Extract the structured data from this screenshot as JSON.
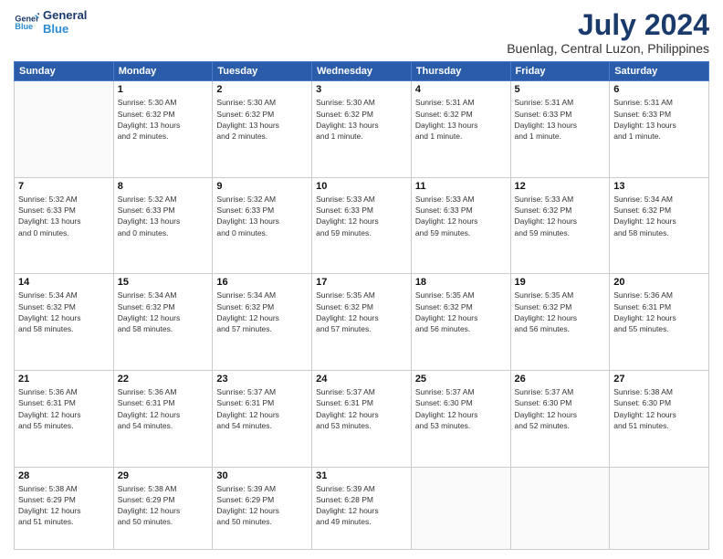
{
  "header": {
    "logo_line1": "General",
    "logo_line2": "Blue",
    "month": "July 2024",
    "location": "Buenlag, Central Luzon, Philippines"
  },
  "weekdays": [
    "Sunday",
    "Monday",
    "Tuesday",
    "Wednesday",
    "Thursday",
    "Friday",
    "Saturday"
  ],
  "weeks": [
    [
      {
        "day": "",
        "info": ""
      },
      {
        "day": "1",
        "info": "Sunrise: 5:30 AM\nSunset: 6:32 PM\nDaylight: 13 hours\nand 2 minutes."
      },
      {
        "day": "2",
        "info": "Sunrise: 5:30 AM\nSunset: 6:32 PM\nDaylight: 13 hours\nand 2 minutes."
      },
      {
        "day": "3",
        "info": "Sunrise: 5:30 AM\nSunset: 6:32 PM\nDaylight: 13 hours\nand 1 minute."
      },
      {
        "day": "4",
        "info": "Sunrise: 5:31 AM\nSunset: 6:32 PM\nDaylight: 13 hours\nand 1 minute."
      },
      {
        "day": "5",
        "info": "Sunrise: 5:31 AM\nSunset: 6:33 PM\nDaylight: 13 hours\nand 1 minute."
      },
      {
        "day": "6",
        "info": "Sunrise: 5:31 AM\nSunset: 6:33 PM\nDaylight: 13 hours\nand 1 minute."
      }
    ],
    [
      {
        "day": "7",
        "info": "Sunrise: 5:32 AM\nSunset: 6:33 PM\nDaylight: 13 hours\nand 0 minutes."
      },
      {
        "day": "8",
        "info": "Sunrise: 5:32 AM\nSunset: 6:33 PM\nDaylight: 13 hours\nand 0 minutes."
      },
      {
        "day": "9",
        "info": "Sunrise: 5:32 AM\nSunset: 6:33 PM\nDaylight: 13 hours\nand 0 minutes."
      },
      {
        "day": "10",
        "info": "Sunrise: 5:33 AM\nSunset: 6:33 PM\nDaylight: 12 hours\nand 59 minutes."
      },
      {
        "day": "11",
        "info": "Sunrise: 5:33 AM\nSunset: 6:33 PM\nDaylight: 12 hours\nand 59 minutes."
      },
      {
        "day": "12",
        "info": "Sunrise: 5:33 AM\nSunset: 6:32 PM\nDaylight: 12 hours\nand 59 minutes."
      },
      {
        "day": "13",
        "info": "Sunrise: 5:34 AM\nSunset: 6:32 PM\nDaylight: 12 hours\nand 58 minutes."
      }
    ],
    [
      {
        "day": "14",
        "info": "Sunrise: 5:34 AM\nSunset: 6:32 PM\nDaylight: 12 hours\nand 58 minutes."
      },
      {
        "day": "15",
        "info": "Sunrise: 5:34 AM\nSunset: 6:32 PM\nDaylight: 12 hours\nand 58 minutes."
      },
      {
        "day": "16",
        "info": "Sunrise: 5:34 AM\nSunset: 6:32 PM\nDaylight: 12 hours\nand 57 minutes."
      },
      {
        "day": "17",
        "info": "Sunrise: 5:35 AM\nSunset: 6:32 PM\nDaylight: 12 hours\nand 57 minutes."
      },
      {
        "day": "18",
        "info": "Sunrise: 5:35 AM\nSunset: 6:32 PM\nDaylight: 12 hours\nand 56 minutes."
      },
      {
        "day": "19",
        "info": "Sunrise: 5:35 AM\nSunset: 6:32 PM\nDaylight: 12 hours\nand 56 minutes."
      },
      {
        "day": "20",
        "info": "Sunrise: 5:36 AM\nSunset: 6:31 PM\nDaylight: 12 hours\nand 55 minutes."
      }
    ],
    [
      {
        "day": "21",
        "info": "Sunrise: 5:36 AM\nSunset: 6:31 PM\nDaylight: 12 hours\nand 55 minutes."
      },
      {
        "day": "22",
        "info": "Sunrise: 5:36 AM\nSunset: 6:31 PM\nDaylight: 12 hours\nand 54 minutes."
      },
      {
        "day": "23",
        "info": "Sunrise: 5:37 AM\nSunset: 6:31 PM\nDaylight: 12 hours\nand 54 minutes."
      },
      {
        "day": "24",
        "info": "Sunrise: 5:37 AM\nSunset: 6:31 PM\nDaylight: 12 hours\nand 53 minutes."
      },
      {
        "day": "25",
        "info": "Sunrise: 5:37 AM\nSunset: 6:30 PM\nDaylight: 12 hours\nand 53 minutes."
      },
      {
        "day": "26",
        "info": "Sunrise: 5:37 AM\nSunset: 6:30 PM\nDaylight: 12 hours\nand 52 minutes."
      },
      {
        "day": "27",
        "info": "Sunrise: 5:38 AM\nSunset: 6:30 PM\nDaylight: 12 hours\nand 51 minutes."
      }
    ],
    [
      {
        "day": "28",
        "info": "Sunrise: 5:38 AM\nSunset: 6:29 PM\nDaylight: 12 hours\nand 51 minutes."
      },
      {
        "day": "29",
        "info": "Sunrise: 5:38 AM\nSunset: 6:29 PM\nDaylight: 12 hours\nand 50 minutes."
      },
      {
        "day": "30",
        "info": "Sunrise: 5:39 AM\nSunset: 6:29 PM\nDaylight: 12 hours\nand 50 minutes."
      },
      {
        "day": "31",
        "info": "Sunrise: 5:39 AM\nSunset: 6:28 PM\nDaylight: 12 hours\nand 49 minutes."
      },
      {
        "day": "",
        "info": ""
      },
      {
        "day": "",
        "info": ""
      },
      {
        "day": "",
        "info": ""
      }
    ]
  ]
}
